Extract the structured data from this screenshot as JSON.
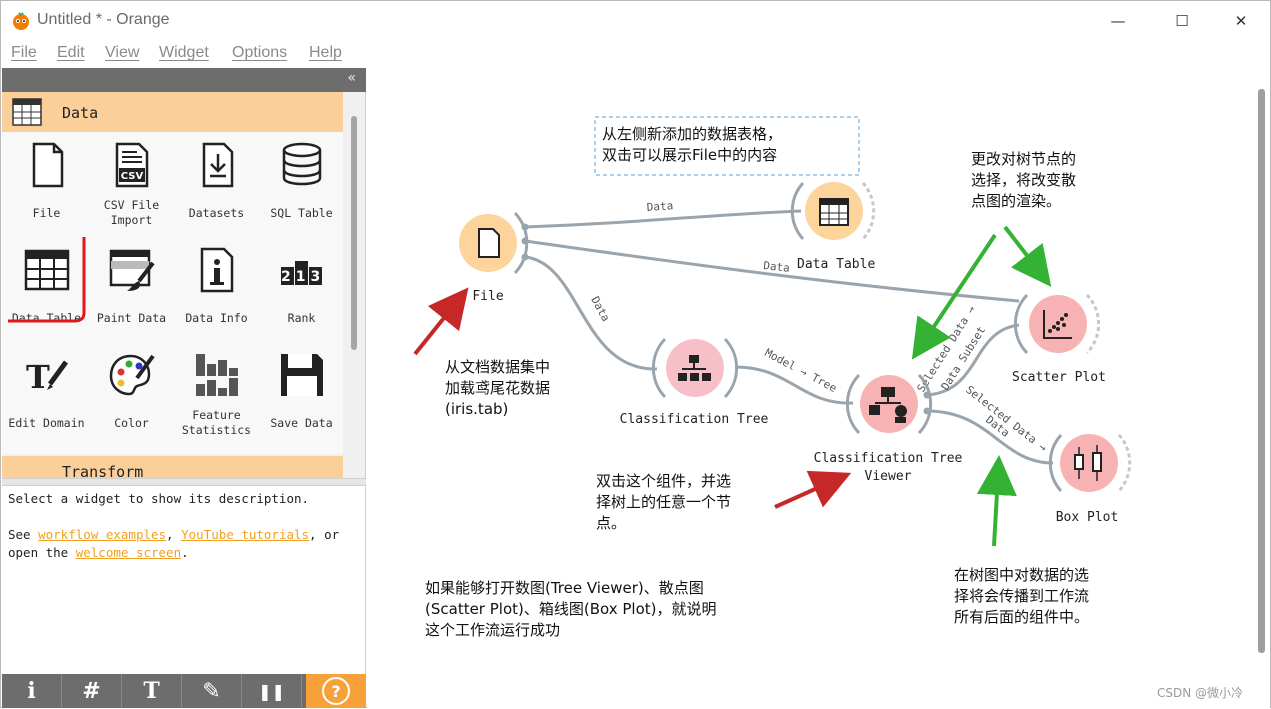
{
  "window": {
    "title": "Untitled * - Orange",
    "minimize": "—",
    "maximize": "☐",
    "close": "✕"
  },
  "menu": [
    "File",
    "Edit",
    "View",
    "Widget",
    "Options",
    "Help"
  ],
  "toolbox": {
    "collapse_icon": "«",
    "category": "Data",
    "widgets": [
      {
        "label": "File",
        "icon": "file-icon"
      },
      {
        "label": "CSV File Import",
        "icon": "csv-icon"
      },
      {
        "label": "Datasets",
        "icon": "datasets-icon"
      },
      {
        "label": "SQL Table",
        "icon": "sql-icon"
      },
      {
        "label": "Data Table",
        "icon": "table-icon"
      },
      {
        "label": "Paint Data",
        "icon": "paint-icon"
      },
      {
        "label": "Data Info",
        "icon": "info-icon"
      },
      {
        "label": "Rank",
        "icon": "rank-icon"
      },
      {
        "label": "Edit Domain",
        "icon": "edit-domain-icon"
      },
      {
        "label": "Color",
        "icon": "palette-icon"
      },
      {
        "label": "Feature Statistics",
        "icon": "stats-icon"
      },
      {
        "label": "Save Data",
        "icon": "save-icon"
      }
    ],
    "next_category": "Transform",
    "rank_digits": "213"
  },
  "description": {
    "line1": "Select a widget to show its description.",
    "see": "See ",
    "link1": "workflow examples",
    "comma": ", ",
    "link2": "YouTube tutorials",
    "or": ", or",
    "open_the": "open the ",
    "link3": "welcome screen",
    "period": "."
  },
  "canvas": {
    "nodes": {
      "file": "File",
      "data_table": "Data Table",
      "scatter_plot": "Scatter Plot",
      "classification_tree": "Classification Tree",
      "tree_viewer_1": "Classification Tree",
      "tree_viewer_2": "Viewer",
      "box_plot": "Box Plot"
    },
    "links": {
      "file_table": "Data",
      "file_scatter": "Data",
      "file_tree": "Data",
      "tree_viewer": "Model → Tree",
      "viewer_scatter_1": "Selected Data →",
      "viewer_scatter_2": "Data Subset",
      "viewer_box_1": "Selected Data →",
      "viewer_box_2": "Data"
    },
    "annotations": {
      "top": [
        "从左侧新添加的数据表格，",
        "双击可以展示File中的内容"
      ],
      "top_right": [
        "更改对树节点的",
        "选择，将改变散",
        "点图的渲染。"
      ],
      "left": [
        "从文档数据集中",
        "加载鸢尾花数据",
        "(iris.tab)"
      ],
      "middle": [
        "双击这个组件，并选",
        "择树上的任意一个节",
        "点。"
      ],
      "bottom_left": [
        "如果能够打开数图(Tree Viewer)、散点图",
        "(Scatter Plot)、箱线图(Box Plot)，就说明",
        "这个工作流运行成功"
      ],
      "bottom_right": [
        "在树图中对数据的选",
        "择将会传播到工作流",
        "所有后面的组件中。"
      ]
    }
  },
  "bottom_toolbar": {
    "info": "i",
    "grid": "#",
    "text": "T",
    "pen": "✎",
    "pause": "❚❚",
    "help": "?"
  },
  "watermark": "CSDN @微小冷",
  "colors": {
    "accent": "#fbcf9a",
    "node_orange": "#fcd49c",
    "node_red": "#f7b3b3",
    "arrow_red": "#c62828",
    "arrow_green": "#33b233",
    "link_blue": "#f0a020"
  }
}
